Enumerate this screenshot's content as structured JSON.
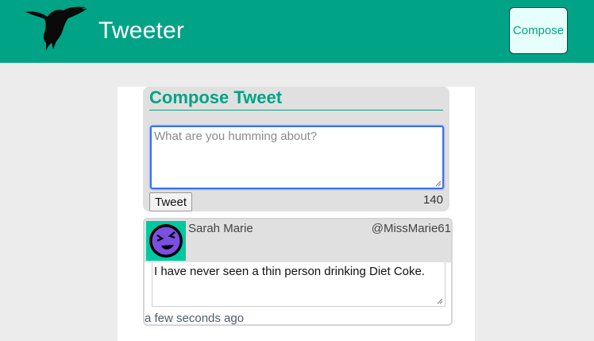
{
  "header": {
    "brand": "Tweeter",
    "compose_label": "Compose",
    "logo_icon": "hummingbird-icon",
    "bg_color": "#00a386"
  },
  "compose": {
    "title": "Compose Tweet",
    "placeholder": "What are you humming about?",
    "value": "",
    "submit_label": "Tweet",
    "counter": "140"
  },
  "tweets": [
    {
      "name": "Sarah Marie",
      "handle": "@MissMarie61",
      "text": "I have never seen a thin person drinking  Diet Coke.",
      "time": "a few seconds ago",
      "avatar_icon": "laughing-face-icon"
    }
  ]
}
